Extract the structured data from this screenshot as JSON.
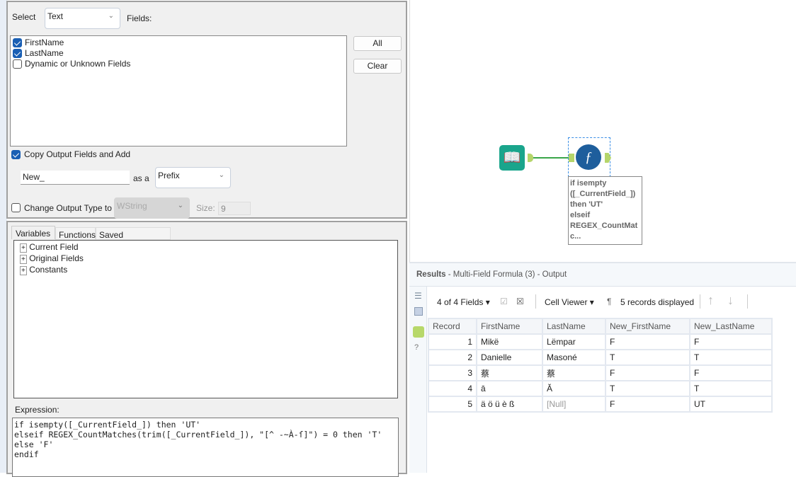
{
  "config": {
    "select_label": "Select",
    "select_value": "Text",
    "fields_label": "Fields:",
    "fields": [
      {
        "label": "FirstName",
        "checked": true
      },
      {
        "label": "LastName",
        "checked": true
      },
      {
        "label": "Dynamic or Unknown Fields",
        "checked": false
      }
    ],
    "all_button": "All",
    "clear_button": "Clear",
    "copy_output_label": "Copy Output Fields and Add",
    "copy_output_checked": true,
    "prefix_value": "New_",
    "as_a_label": "as a",
    "prefix_type": "Prefix",
    "change_type_label": "Change Output Type to",
    "change_type_checked": false,
    "type_value": "WString",
    "size_label": "Size:",
    "size_value": "9"
  },
  "expression_panel": {
    "tabs": [
      "Variables",
      "Functions",
      "Saved Expressions"
    ],
    "tree": [
      "Current Field",
      "Original Fields",
      "Constants"
    ],
    "expression_label": "Expression:",
    "expression": "if isempty([_CurrentField_]) then 'UT'\nelseif REGEX_CountMatches(trim([_CurrentField_]), \"[^ -~À-ſ]\") = 0 then 'T'\nelse 'F'\nendif"
  },
  "canvas": {
    "annotation": "if isempty\n([_CurrentField_])\nthen 'UT'\nelseif\nREGEX_CountMat\nc...",
    "input_color": "#1aa58c",
    "formula_color": "#1e5e9c",
    "connection_color": "#3aa64a"
  },
  "results": {
    "title": "Results",
    "subtitle": " - Multi-Field Formula (3) - Output",
    "fields_selector": "4 of 4 Fields",
    "viewer": "Cell Viewer",
    "records_displayed": "5 records displayed",
    "columns": [
      "Record",
      "FirstName",
      "LastName",
      "New_FirstName",
      "New_LastName"
    ],
    "rows": [
      [
        "1",
        "Mikë",
        "Lëmpar",
        "F",
        "F"
      ],
      [
        "2",
        "Danielle",
        "Masoné",
        "T",
        "T"
      ],
      [
        "3",
        "蔡",
        "蔡",
        "F",
        "F"
      ],
      [
        "4",
        "ā",
        "Ă",
        "T",
        "T"
      ],
      [
        "5",
        "ä ö ü è ß",
        "[Null]",
        "F",
        "UT"
      ]
    ]
  }
}
